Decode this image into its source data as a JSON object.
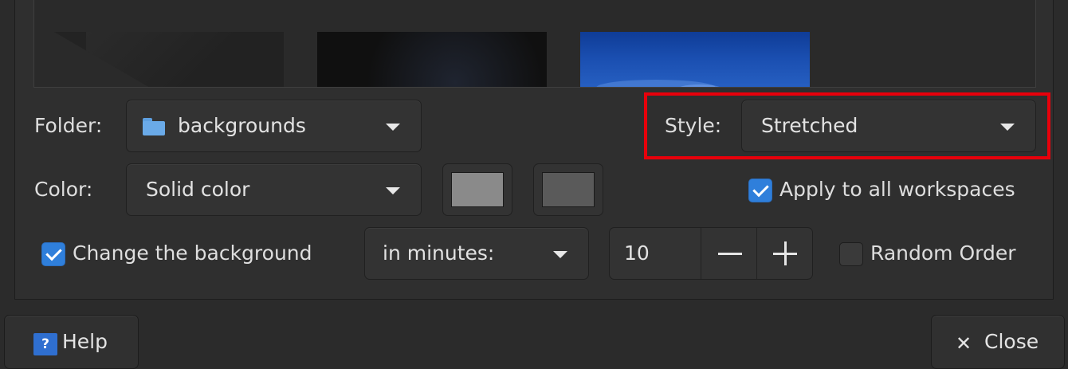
{
  "folder": {
    "label": "Folder:",
    "value": "backgrounds",
    "icon": "folder-icon"
  },
  "style": {
    "label": "Style:",
    "value": "Stretched"
  },
  "color": {
    "label": "Color:",
    "value": "Solid color",
    "primary_color": "#8a8a8a",
    "secondary_color": "#5a5a5a"
  },
  "apply_all": {
    "label": "Apply to all workspaces",
    "checked": true
  },
  "change_bg": {
    "label": "Change the background",
    "checked": true
  },
  "interval": {
    "value": "in minutes:",
    "amount": "10"
  },
  "random_order": {
    "label": "Random Order",
    "checked": false
  },
  "buttons": {
    "help": "Help",
    "close": "Close"
  },
  "colors": {
    "accent": "#2f7fdb",
    "highlight": "#e8000b"
  }
}
